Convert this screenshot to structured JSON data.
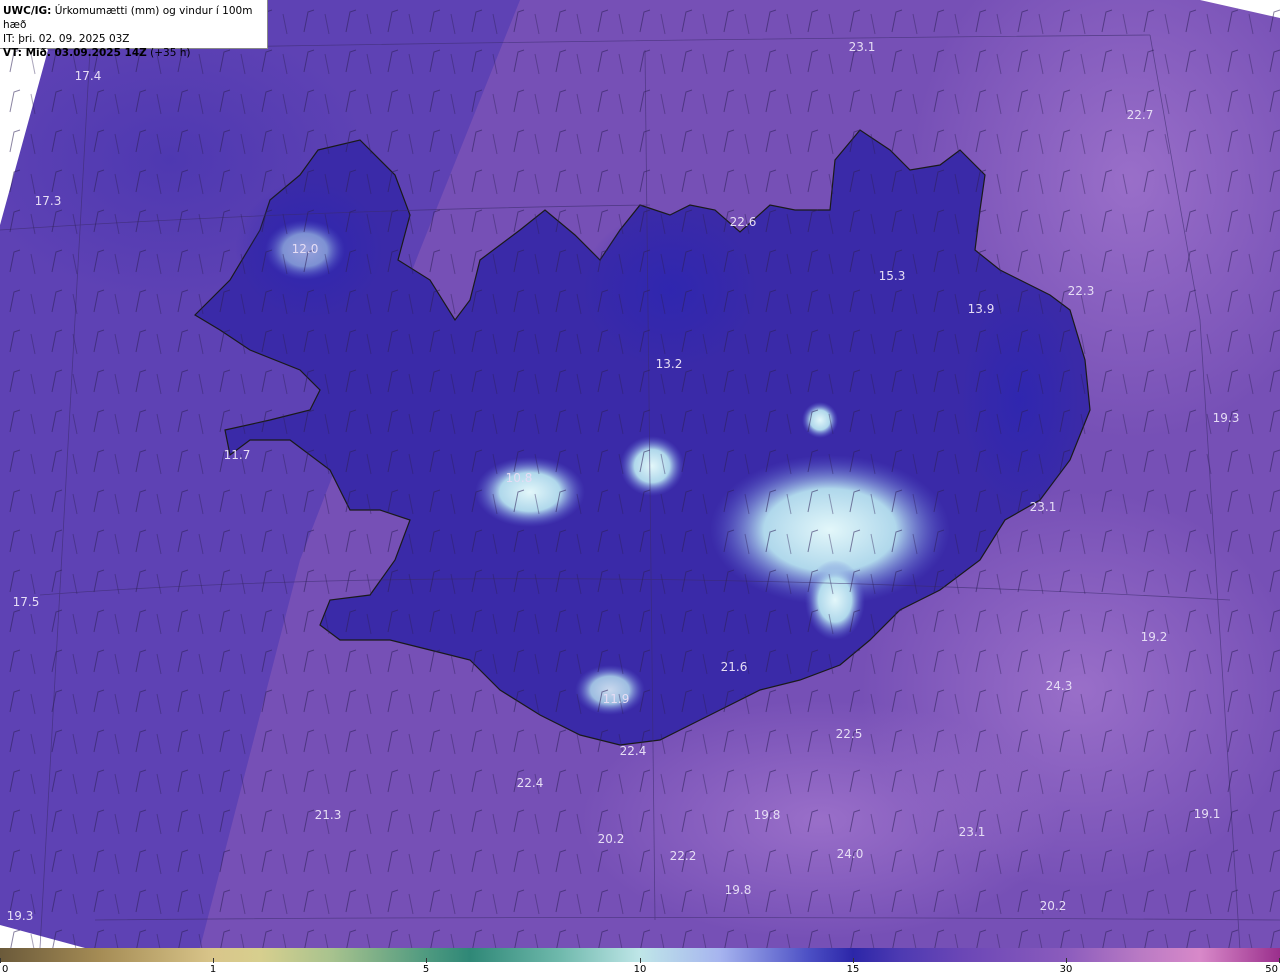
{
  "header": {
    "line1_bold": "UWC/IG:",
    "line1_rest": " Úrkomumætti (mm) og vindur í 100m hæð",
    "line2": "IT: þri. 02. 09. 2025 03Z",
    "line3_bold": "VT: Mið. 03.09.2025 14Z",
    "line3_rest": " (+35 h)"
  },
  "colors": {
    "sea_base": "#7a54b8",
    "land_base": "#3f2fa8",
    "high_precip": "#c9eef4",
    "coast": "#1a1a1a"
  },
  "colorbar": {
    "ticks": [
      "0",
      "1",
      "5",
      "10",
      "15",
      "30",
      "50"
    ]
  },
  "map_labels": [
    {
      "id": "l1",
      "text": "23.1"
    },
    {
      "id": "l2",
      "text": "17.4"
    },
    {
      "id": "l3",
      "text": "22.7"
    },
    {
      "id": "l4",
      "text": "17.3"
    },
    {
      "id": "l5",
      "text": "22.6"
    },
    {
      "id": "l6",
      "text": "12.0"
    },
    {
      "id": "l7",
      "text": "15.3"
    },
    {
      "id": "l8",
      "text": "22.3"
    },
    {
      "id": "l9",
      "text": "13.9"
    },
    {
      "id": "l10",
      "text": "13.2"
    },
    {
      "id": "l11",
      "text": "19.3"
    },
    {
      "id": "l12",
      "text": "11.7"
    },
    {
      "id": "l13",
      "text": "10.8"
    },
    {
      "id": "l14",
      "text": "23.1"
    },
    {
      "id": "l15",
      "text": "17.5"
    },
    {
      "id": "l16",
      "text": "19.2"
    },
    {
      "id": "l17",
      "text": "21.6"
    },
    {
      "id": "l18",
      "text": "24.3"
    },
    {
      "id": "l19",
      "text": "11.9"
    },
    {
      "id": "l20",
      "text": "22.5"
    },
    {
      "id": "l21",
      "text": "22.4"
    },
    {
      "id": "l22",
      "text": "22.4"
    },
    {
      "id": "l23",
      "text": "21.3"
    },
    {
      "id": "l24",
      "text": "19.8"
    },
    {
      "id": "l25",
      "text": "20.2"
    },
    {
      "id": "l26",
      "text": "23.1"
    },
    {
      "id": "l27",
      "text": "19.1"
    },
    {
      "id": "l28",
      "text": "24.0"
    },
    {
      "id": "l29",
      "text": "22.2"
    },
    {
      "id": "l30",
      "text": "19.8"
    },
    {
      "id": "l31",
      "text": "19.3"
    },
    {
      "id": "l32",
      "text": "20.2"
    }
  ]
}
